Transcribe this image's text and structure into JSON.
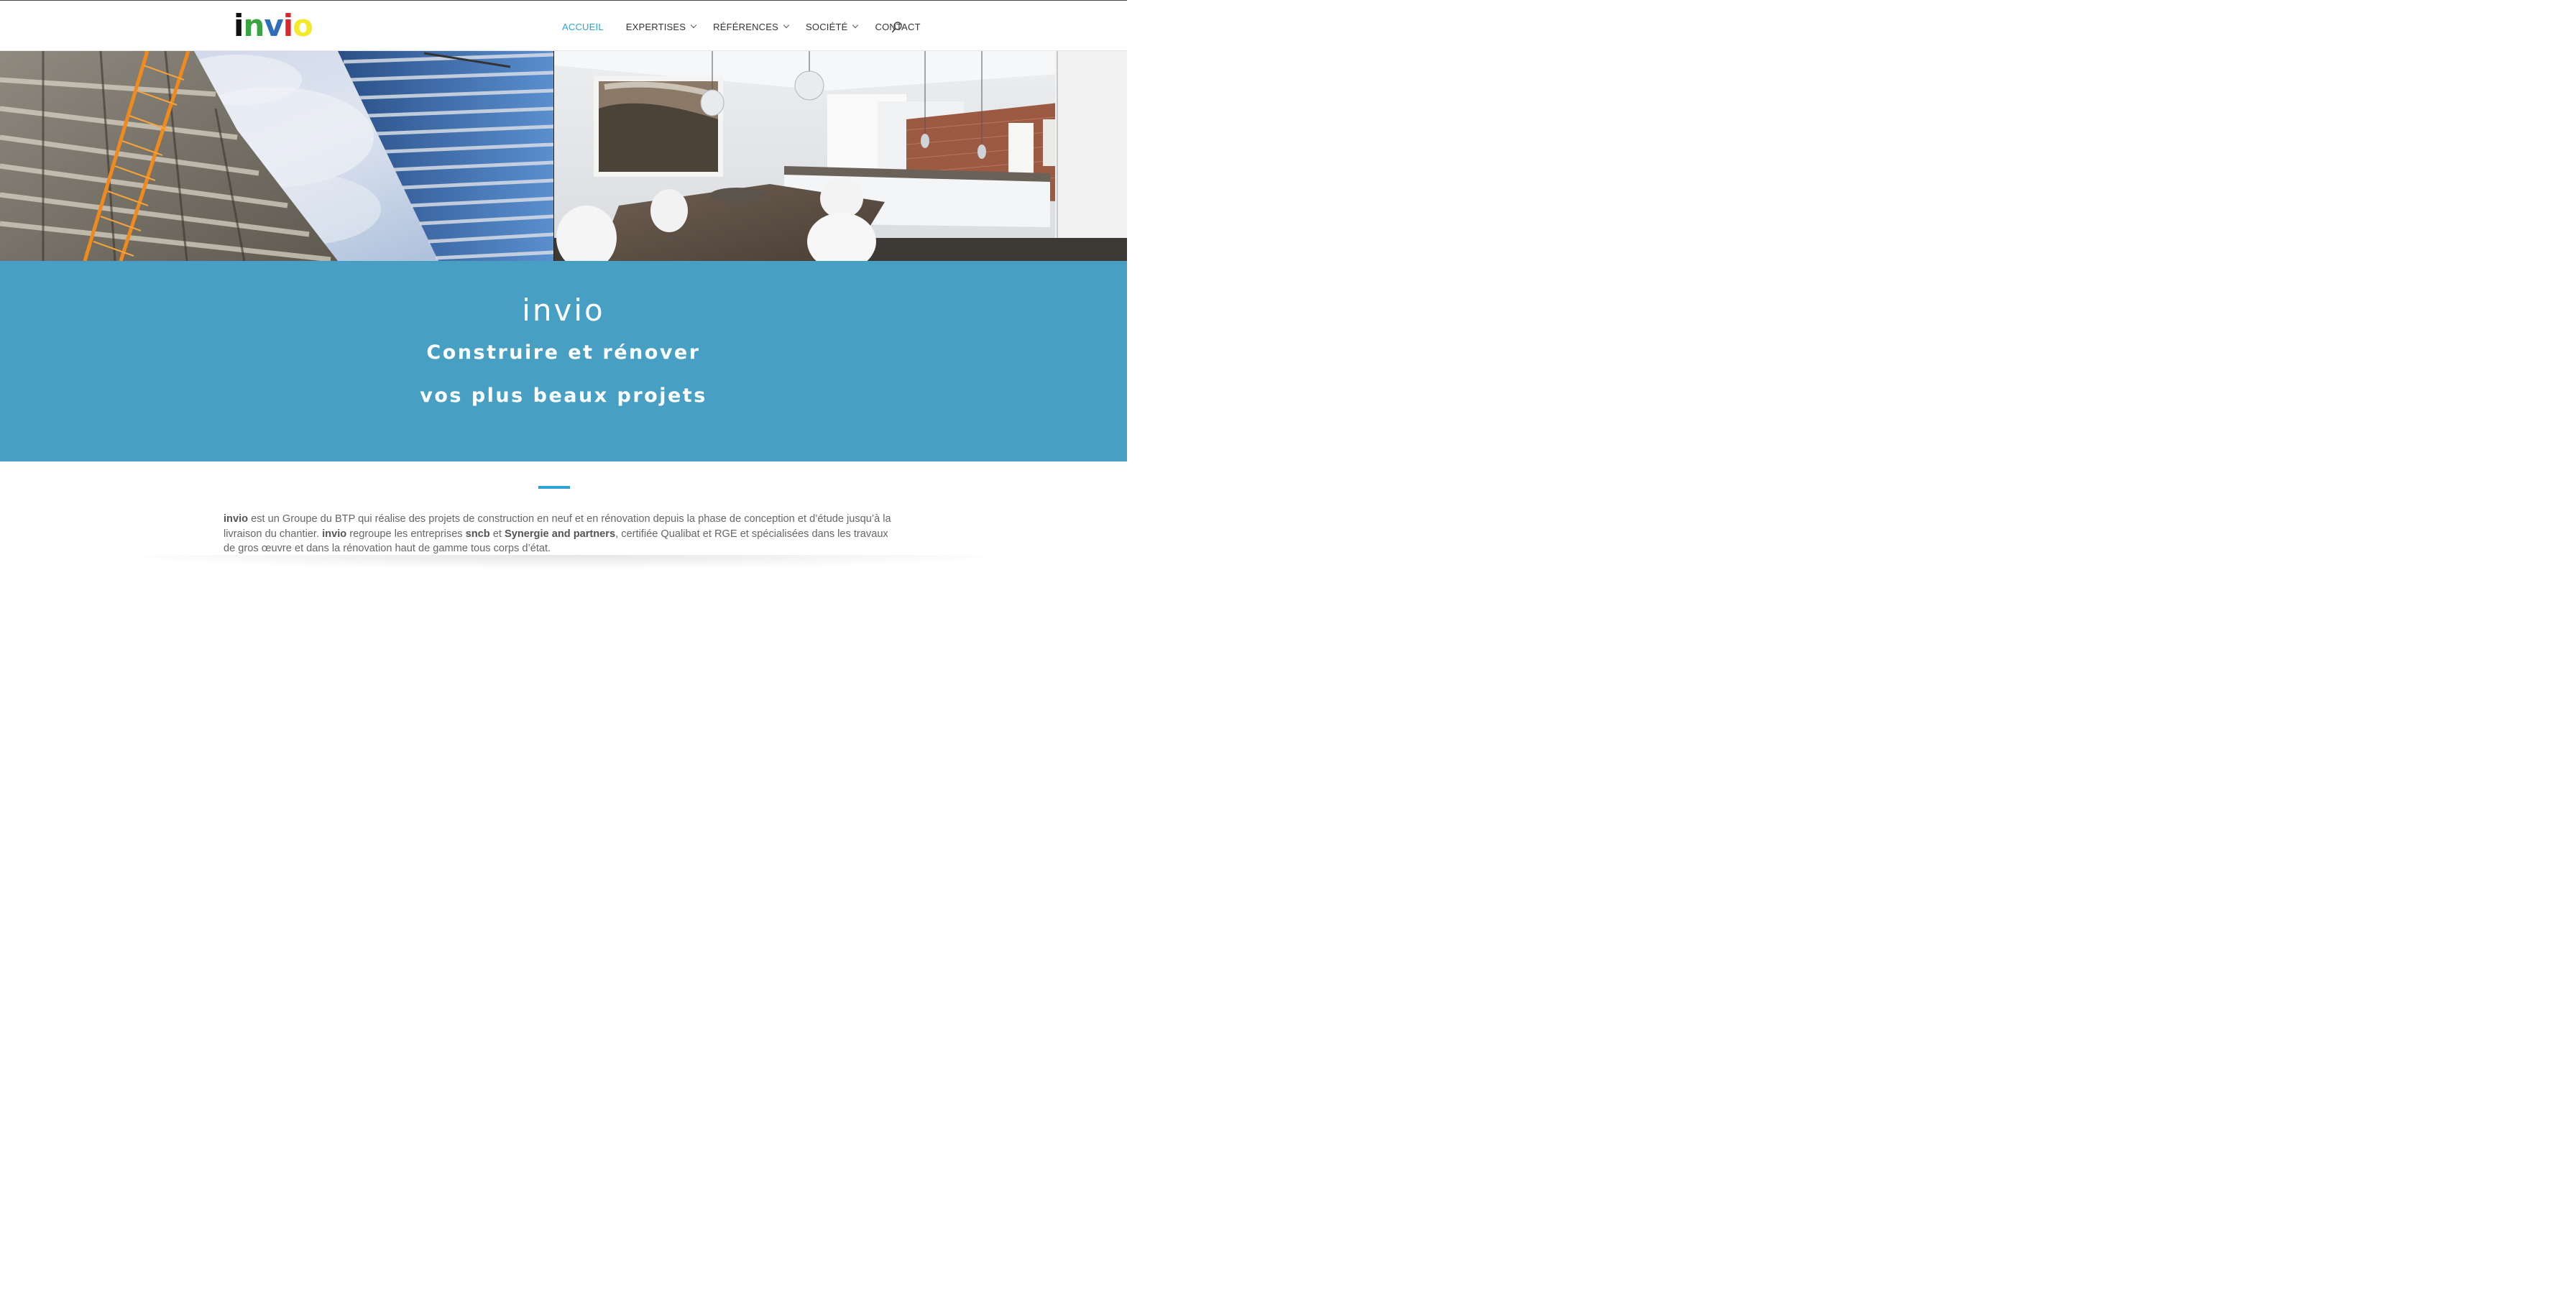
{
  "brand": {
    "logo_letters": [
      {
        "char": "i",
        "color": "#111111"
      },
      {
        "char": "n",
        "color": "#3aa441"
      },
      {
        "char": "v",
        "color": "#2f6fba"
      },
      {
        "char": "i",
        "color": "#d7282f"
      },
      {
        "char": "o",
        "color": "#f2ea2a"
      }
    ]
  },
  "nav": {
    "items": [
      {
        "label": "ACCUEIL",
        "active": true,
        "has_dropdown": false
      },
      {
        "label": "EXPERTISES",
        "active": false,
        "has_dropdown": true
      },
      {
        "label": "RÉFÉRENCES",
        "active": false,
        "has_dropdown": true
      },
      {
        "label": "SOCIÉTÉ",
        "active": false,
        "has_dropdown": true
      },
      {
        "label": "CONTACT",
        "active": false,
        "has_dropdown": false
      }
    ],
    "search_icon": "search-icon",
    "active_color": "#2ea3d3"
  },
  "hero": {
    "left_image": "construction-crane-tower-photo",
    "right_image": "modern-kitchen-dining-photo"
  },
  "band": {
    "title": "invio",
    "line1": "Construire et rénover",
    "line2": "vos plus beaux projets",
    "background": "#47a0c4"
  },
  "intro": {
    "brand1": "invio",
    "text1": " est un Groupe du BTP qui réalise des projets de construction en neuf et en rénovation depuis la phase de conception et d’étude jusqu’à la livraison du chantier. ",
    "brand2": "invio",
    "text2": " regroupe les entreprises ",
    "company1": "sncb",
    "text3": " et ",
    "company2": "Synergie and partners",
    "text4": ", certifiée Qualibat et RGE et spécialisées dans les travaux de gros œuvre et dans la rénovation haut de gamme tous corps d’état."
  }
}
